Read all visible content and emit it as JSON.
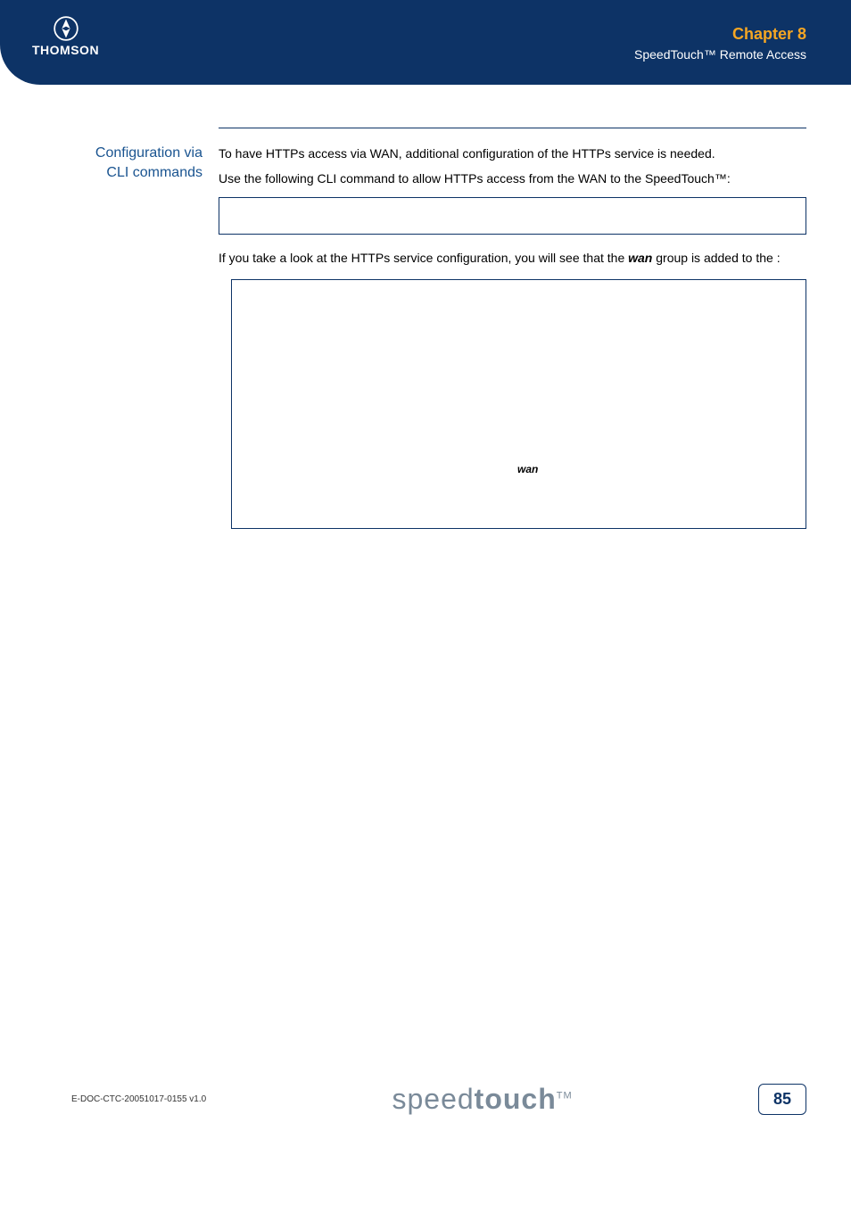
{
  "header": {
    "logo_text": "THOMSON",
    "chapter": "Chapter 8",
    "subtitle": "SpeedTouch™ Remote Access"
  },
  "section": {
    "heading_line1": "Configuration via",
    "heading_line2": "CLI commands"
  },
  "body": {
    "para1": "To have HTTPs access via WAN, additional configuration of the HTTPs service is needed.",
    "para2": "Use the following CLI command to allow HTTPs access from the WAN to the SpeedTouch™:",
    "para3a": "If you take a look at the HTTPs service configuration, you will see that the ",
    "para3_bold": "wan",
    "para3b": " group is added to the ",
    "para3c": ":"
  },
  "code1": "",
  "code2_wan": "wan",
  "footer": {
    "doc_id": "E-DOC-CTC-20051017-0155 v1.0",
    "logo_light": "speed",
    "logo_bold": "touch",
    "logo_tm": "TM",
    "page": "85"
  }
}
